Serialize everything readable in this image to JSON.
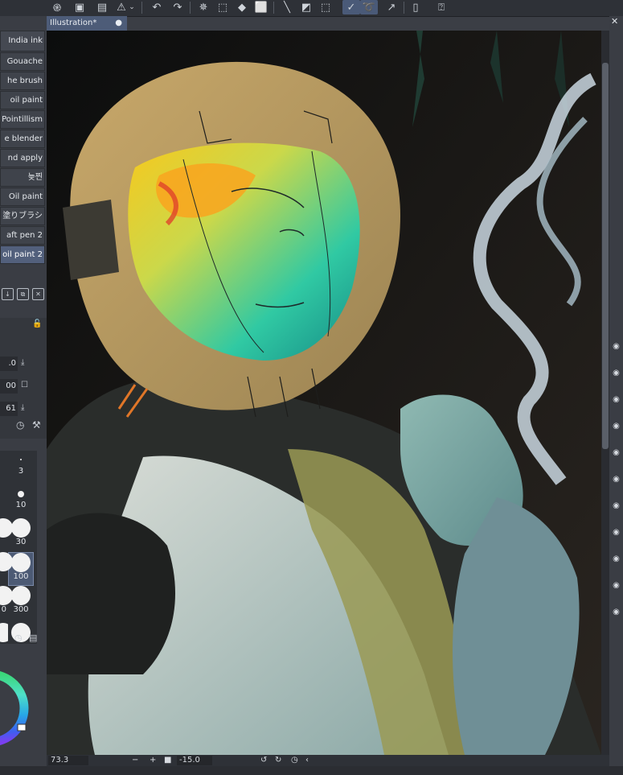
{
  "toolbar": {
    "icons": [
      "spiral-icon",
      "new-layer-icon",
      "folder-icon",
      "warning-icon",
      "chevron-down-icon",
      "undo-icon",
      "redo-icon",
      "loading-icon",
      "transform-icon",
      "fill-icon",
      "select-box-icon",
      "ruler-off-icon",
      "mask-icon",
      "select-clear-icon",
      "pen-active-icon",
      "lasso-active-icon",
      "export-icon",
      "phone-icon",
      "help-icon"
    ]
  },
  "document": {
    "tab_title": "Illustration*",
    "close_glyph": "●"
  },
  "brush_panel": {
    "items": [
      {
        "label": "India ink",
        "active": false
      },
      {
        "label": "Gouache",
        "active": false
      },
      {
        "label": "he brush",
        "active": false
      },
      {
        "label": "oil paint",
        "active": false
      },
      {
        "label": "Pointillism",
        "active": false
      },
      {
        "label": "e blender",
        "active": false
      },
      {
        "label": "nd apply",
        "active": false
      },
      {
        "label": "늦찐",
        "active": false
      },
      {
        "label": "Oil paint",
        "active": false
      },
      {
        "label": "塗りブラシ",
        "active": false
      },
      {
        "label": "aft pen 2",
        "active": false
      },
      {
        "label": "oil paint 2",
        "active": true
      }
    ]
  },
  "properties": {
    "values": [
      ".0",
      "00",
      "61"
    ]
  },
  "brush_sizes": {
    "labels": [
      "3",
      "10",
      "30",
      "100",
      "300",
      "0"
    ],
    "active": "100"
  },
  "status": {
    "zoom": "73.3",
    "rotation": "-15.0"
  },
  "colors": {
    "panel": "#3a3d44",
    "accent": "#52607c"
  }
}
